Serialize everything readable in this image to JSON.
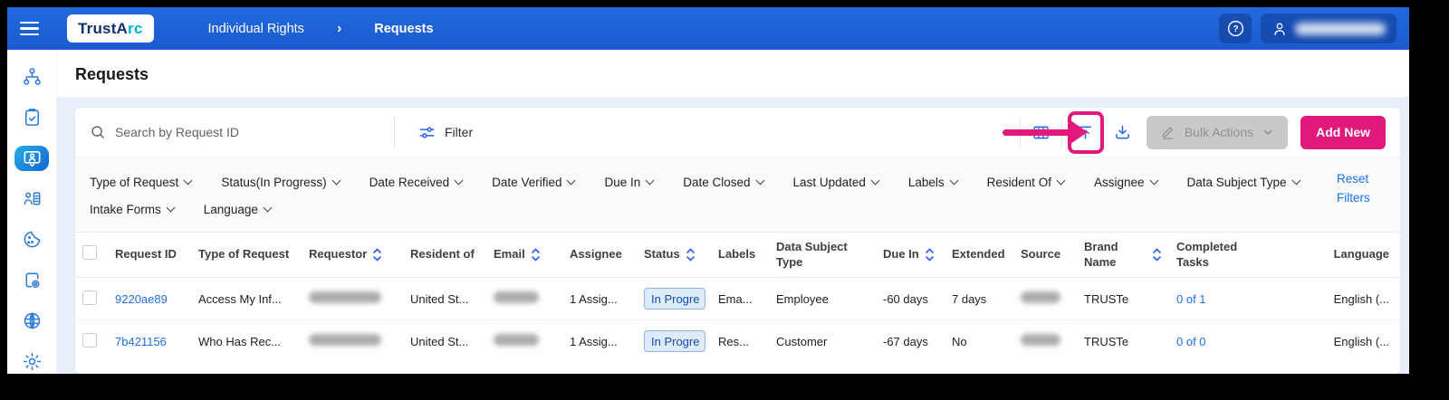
{
  "header": {
    "brand_part1": "TrustA",
    "brand_part2": "rc",
    "breadcrumb_section": "Individual Rights",
    "breadcrumb_chevron": "›",
    "breadcrumb_page": "Requests",
    "help_glyph": "?"
  },
  "sidebar": {
    "icons": [
      "hierarchy-icon",
      "clipboard-check-icon",
      "screen-user-icon",
      "user-list-icon",
      "cookie-icon",
      "document-at-icon",
      "brain-icon",
      "gear-icon"
    ],
    "active_index": 2
  },
  "page": {
    "title": "Requests"
  },
  "toolbar": {
    "search_placeholder": "Search by Request ID",
    "filter_label": "Filter",
    "bulk_actions_label": "Bulk Actions",
    "add_new_label": "Add New"
  },
  "filters": {
    "row1": [
      "Type of Request",
      "Status(In Progress)",
      "Date Received",
      "Date Verified",
      "Due In",
      "Date Closed",
      "Last Updated",
      "Labels",
      "Resident Of",
      "Assignee",
      "Data Subject Type"
    ],
    "row2": [
      "Intake Forms",
      "Language"
    ],
    "reset_label": "Reset Filters"
  },
  "table": {
    "columns": [
      "",
      "Request ID",
      "Type of Request",
      "Requestor",
      "Resident of",
      "Email",
      "Assignee",
      "Status",
      "Labels",
      "Data Subject Type",
      "Due In",
      "Extended",
      "Source",
      "Brand Name",
      "Completed Tasks",
      "Language"
    ],
    "sortable_columns": [
      "Requestor",
      "Email",
      "Status",
      "Due In",
      "Brand Name"
    ],
    "rows": [
      {
        "request_id": "9220ae89",
        "type_of_request": "Access My Inf...",
        "requestor_redacted": true,
        "resident_of": "United St...",
        "email_redacted": true,
        "assignee": "1 Assig...",
        "status": "In Progre",
        "labels": "Ema...",
        "data_subject_type": "Employee",
        "due_in": "-60 days",
        "extended": "7 days",
        "source_redacted": true,
        "brand_name": "TRUSTe",
        "completed_tasks": "0 of 1",
        "language": "English (..."
      },
      {
        "request_id": "7b421156",
        "type_of_request": "Who Has Rec...",
        "requestor_redacted": true,
        "resident_of": "United St...",
        "email_redacted": true,
        "assignee": "1 Assig...",
        "status": "In Progre",
        "labels": "Res...",
        "data_subject_type": "Customer",
        "due_in": "-67 days",
        "extended": "No",
        "source_redacted": true,
        "brand_name": "TRUSTe",
        "completed_tasks": "0 of 0",
        "language": "English (..."
      }
    ]
  },
  "colors": {
    "header_blue": "#1B61D2",
    "accent_pink": "#E2187D",
    "link_blue": "#2171E8",
    "icon_blue": "#2E7CD6",
    "badge_bg": "#DEEBFB",
    "badge_border": "#8CB4EE",
    "badge_text": "#174EA6"
  }
}
